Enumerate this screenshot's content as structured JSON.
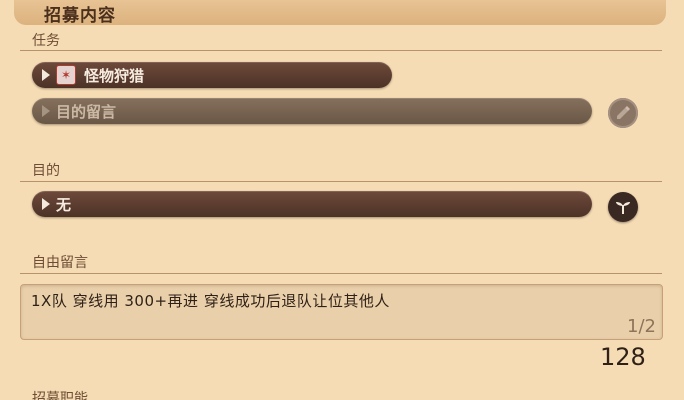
{
  "header": {
    "title": "招募内容"
  },
  "sections": {
    "task": {
      "label": "任务",
      "duty": {
        "label": "怪物狩猎",
        "icon": "monster-hunt-icon"
      },
      "purpose_note": {
        "label": "目的留言",
        "enabled": false,
        "button_icon": "edit-icon"
      }
    },
    "purpose": {
      "label": "目的",
      "select": {
        "value": "无",
        "button_icon": "sprout-icon"
      }
    },
    "free_comment": {
      "label": "自由留言",
      "text": "1X队 穿线用 300+再进 穿线成功后退队让位其他人",
      "page": "1/2",
      "char_count": "128"
    },
    "next_section": {
      "label": "招募职能"
    }
  },
  "colors": {
    "background": "#f6dcb4",
    "pill": "#5a3c2f",
    "accent_red": "#b03a2e"
  }
}
